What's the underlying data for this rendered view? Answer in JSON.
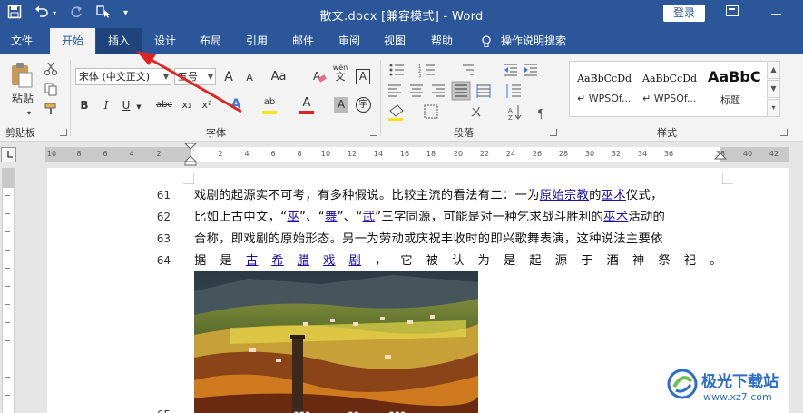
{
  "titlebar": {
    "doc_title": "散文.docx [兼容模式]  -  Word",
    "login_label": "登录"
  },
  "tabs": [
    {
      "label": "文件"
    },
    {
      "label": "开始"
    },
    {
      "label": "插入"
    },
    {
      "label": "设计"
    },
    {
      "label": "布局"
    },
    {
      "label": "引用"
    },
    {
      "label": "邮件"
    },
    {
      "label": "审阅"
    },
    {
      "label": "视图"
    },
    {
      "label": "帮助"
    },
    {
      "label": "操作说明搜索"
    }
  ],
  "ribbon": {
    "clipboard": {
      "paste_label": "粘贴",
      "group_label": "剪贴板"
    },
    "font": {
      "font_name": "宋体 (中文正文)",
      "font_size": "五号",
      "group_label": "字体",
      "grow_label": "A",
      "shrink_label": "A",
      "case_label": "Aa",
      "phonetic_label": "wén",
      "phonetic_char": "文",
      "border_char": "A",
      "bold": "B",
      "italic": "I",
      "underline": "U",
      "strike": "abc",
      "sub": "x₂",
      "sup": "x²",
      "effect": "A",
      "highlight": "ab",
      "color": "A",
      "shade": "A",
      "enclose": "字"
    },
    "paragraph": {
      "group_label": "段落"
    },
    "styles": {
      "group_label": "样式",
      "items": [
        {
          "preview": "AaBbCcDd",
          "name": "↵ WPSOf..."
        },
        {
          "preview": "AaBbCcDd",
          "name": "↵ WPSOf..."
        },
        {
          "preview": "AaBbC",
          "name": "标题"
        }
      ]
    }
  },
  "ruler": {
    "labels": [
      "10",
      "8",
      "6",
      "4",
      "2",
      "2",
      "4",
      "6",
      "8",
      "10",
      "12",
      "14",
      "16",
      "18",
      "20",
      "22",
      "24",
      "26",
      "28",
      "30",
      "32",
      "34",
      "36",
      "38",
      "40",
      "42"
    ]
  },
  "document": {
    "lines": [
      {
        "num": "61",
        "parts": [
          {
            "t": "戏剧的起源实不可考，有多种假说。比较主流的看法有二：一为"
          },
          {
            "t": "原始宗教",
            "link": true
          },
          {
            "t": "的"
          },
          {
            "t": "巫术",
            "link": true
          },
          {
            "t": "仪式，"
          }
        ]
      },
      {
        "num": "62",
        "parts": [
          {
            "t": "比如上古中文，“"
          },
          {
            "t": "巫",
            "link": true
          },
          {
            "t": "”、“"
          },
          {
            "t": "舞",
            "link": true
          },
          {
            "t": "”、“"
          },
          {
            "t": "武",
            "link": true
          },
          {
            "t": "”三字同源，可能是对一种乞求战斗胜利的"
          },
          {
            "t": "巫术",
            "link": true
          },
          {
            "t": "活动的"
          }
        ]
      },
      {
        "num": "63",
        "parts": [
          {
            "t": "合称，即戏剧的原始形态。另一为劳动或庆祝丰收时的即兴歌舞表演，这种说法主要依"
          }
        ]
      },
      {
        "num": "64",
        "justify": true,
        "chars": [
          {
            "t": "据"
          },
          {
            "t": "是"
          },
          {
            "t": "古",
            "link": true
          },
          {
            "t": "希",
            "link": true
          },
          {
            "t": "腊",
            "link": true
          },
          {
            "t": "戏",
            "link": true
          },
          {
            "t": "剧",
            "link": true
          },
          {
            "t": "，"
          },
          {
            "t": "它"
          },
          {
            "t": "被"
          },
          {
            "t": "认"
          },
          {
            "t": "为"
          },
          {
            "t": "是"
          },
          {
            "t": "起"
          },
          {
            "t": "源"
          },
          {
            "t": "于"
          },
          {
            "t": "酒"
          },
          {
            "t": "神"
          },
          {
            "t": "祭"
          },
          {
            "t": "祀"
          },
          {
            "t": "。"
          }
        ]
      },
      {
        "num": "65",
        "parts": []
      }
    ]
  },
  "watermark": {
    "title": "极光下载站",
    "url": "www.xz7.com"
  }
}
